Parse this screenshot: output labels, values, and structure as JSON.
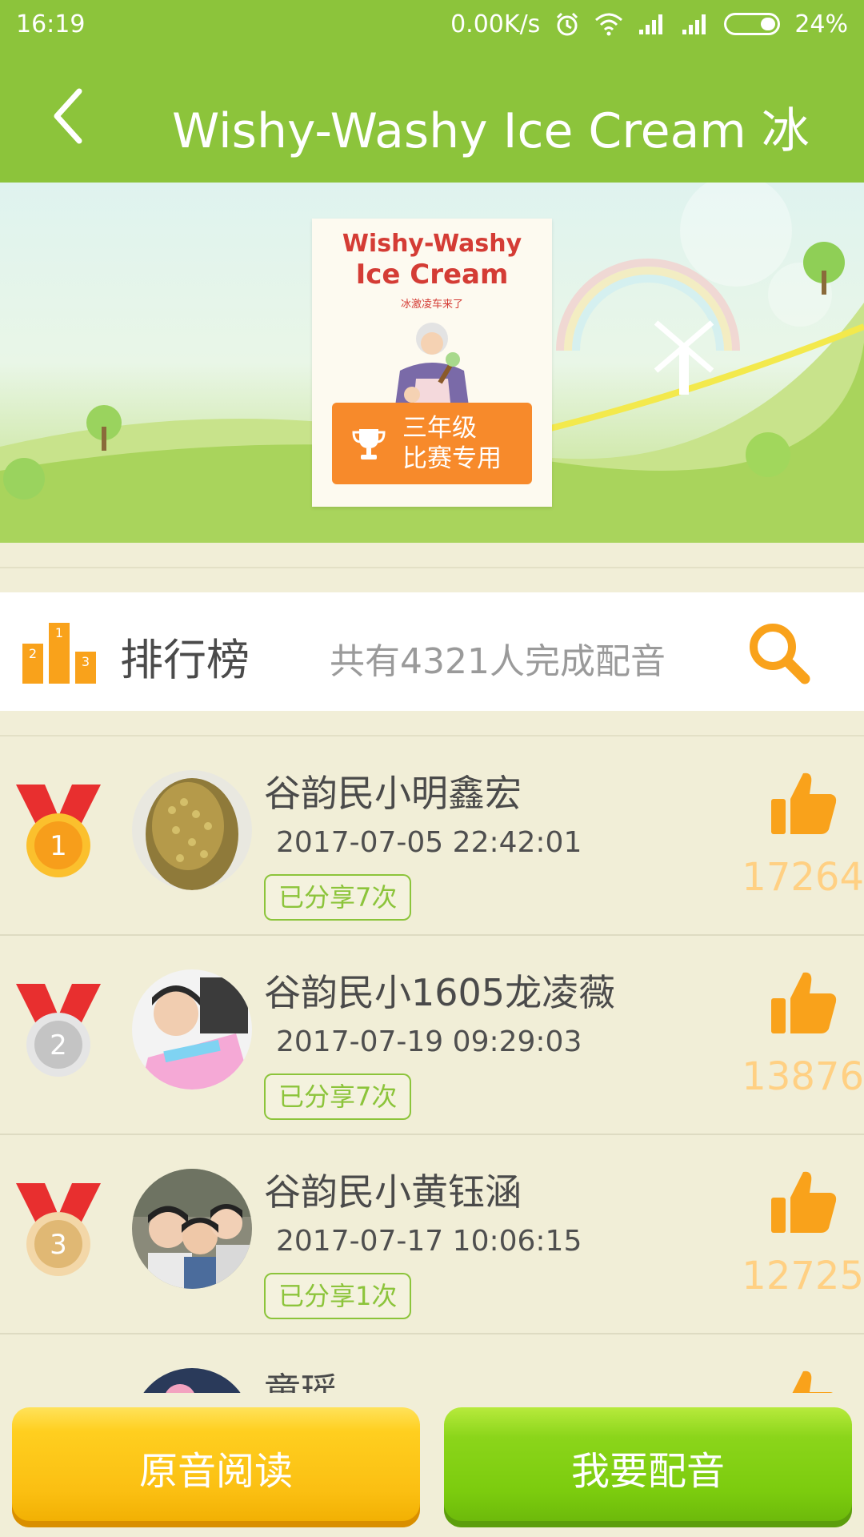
{
  "status_bar": {
    "time": "16:19",
    "network_speed": "0.00K/s",
    "battery": "24%",
    "icons": [
      "alarm-icon",
      "wifi-icon",
      "signal-icon",
      "signal-icon",
      "battery-icon"
    ]
  },
  "header": {
    "title": "Wishy-Washy Ice Cream  冰",
    "back_icon": "chevron-left-icon"
  },
  "book": {
    "cover_title_line1": "Wishy-Washy",
    "cover_title_line2": "Ice Cream",
    "cover_subtitle": "冰激凌车来了",
    "badge_text_line1": "三年级",
    "badge_text_line2": "比赛专用",
    "badge_icon": "trophy-icon"
  },
  "ranking": {
    "title": "排行榜",
    "summary": "共有4321人完成配音",
    "podium_icon": "podium-icon",
    "search_icon": "search-icon"
  },
  "entries": [
    {
      "rank": "1",
      "name": "谷韵民小明鑫宏",
      "date": "2017-07-05 22:42:01",
      "shared": "已分享7次",
      "likes": "17264"
    },
    {
      "rank": "2",
      "name": "谷韵民小1605龙凌薇",
      "date": "2017-07-19 09:29:03",
      "shared": "已分享7次",
      "likes": "13876"
    },
    {
      "rank": "3",
      "name": "谷韵民小黄钰涵",
      "date": "2017-07-17 10:06:15",
      "shared": "已分享1次",
      "likes": "12725"
    },
    {
      "rank": "",
      "name": "童瑶",
      "date": "",
      "shared": "",
      "likes": ""
    }
  ],
  "bottom": {
    "original_label": "原音阅读",
    "dub_label": "我要配音"
  },
  "colors": {
    "brand_green": "#8cc43b",
    "orange": "#f78a2b",
    "like_orange": "#ffd083",
    "medal_red": "#e82f2f"
  }
}
